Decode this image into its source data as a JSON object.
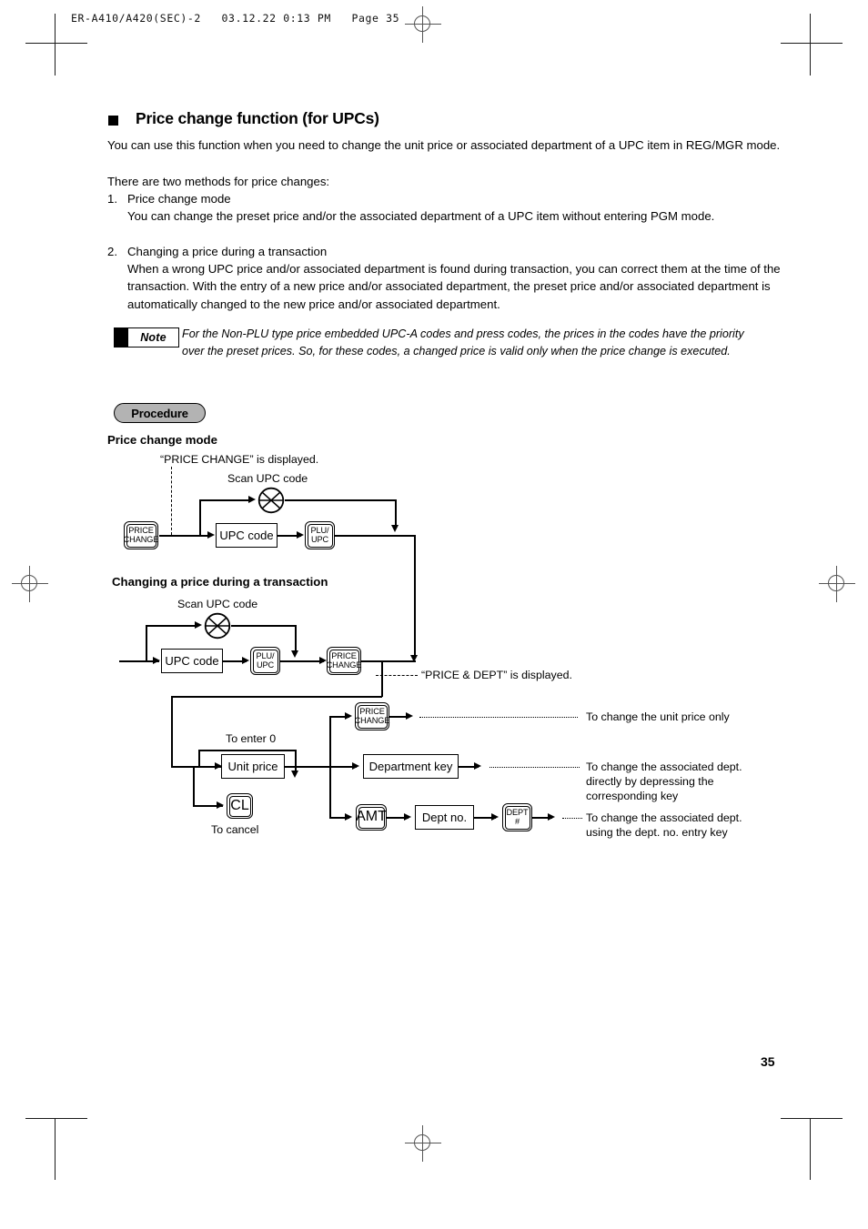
{
  "header": {
    "doc_code": "ER-A410/A420(SEC)-2   03.12.22 0:13 PM   Page 35"
  },
  "page": {
    "number": "35"
  },
  "section": {
    "title": "Price change function (for UPCs)",
    "intro": "You can use this function when you need to change the unit price or associated department of a UPC item in REG/MGR mode.",
    "methods_lead": "There are two methods for price changes:",
    "items": [
      {
        "num": "1.",
        "heading": "Price change mode",
        "body": "You can change the preset price and/or the associated department of a UPC item without entering PGM mode."
      },
      {
        "num": "2.",
        "heading": "Changing a price during a transaction",
        "body": "When a wrong UPC price and/or associated department is found during transaction, you can correct them at the time of the transaction. With the entry of a new price and/or associated department, the preset price and/or associated department is automatically changed to the new price and/or associated department."
      }
    ]
  },
  "note": {
    "badge": "Note",
    "text": "For the Non-PLU type price embedded UPC-A codes and press codes, the prices in the codes have the priority over the preset prices.  So, for these codes, a changed price is valid only when the price change is executed."
  },
  "procedure": {
    "badge": "Procedure"
  },
  "flow1": {
    "heading": "Price change mode",
    "display_note": "“PRICE CHANGE” is displayed.",
    "scan_label": "Scan UPC code",
    "key_price_change_l1": "PRICE",
    "key_price_change_l2": "CHANGE",
    "box_upc_code": "UPC code",
    "key_plu_l1": "PLU/",
    "key_plu_l2": "UPC"
  },
  "flow2": {
    "heading": "Changing a price during a transaction",
    "scan_label": "Scan UPC code",
    "box_upc_code": "UPC code",
    "key_plu_l1": "PLU/",
    "key_plu_l2": "UPC",
    "key_price_change_l1": "PRICE",
    "key_price_change_l2": "CHANGE",
    "display_note": "“PRICE & DEPT” is displayed."
  },
  "flow3": {
    "label_enter_zero": "To enter 0",
    "box_unit_price": "Unit price",
    "key_cl": "CL",
    "label_cancel": "To cancel",
    "branches": [
      {
        "key_l1": "PRICE",
        "key_l2": "CHANGE",
        "result": "To change the unit price only"
      },
      {
        "box": "Department key",
        "result": "To change the associated dept. directly by depressing the corresponding key"
      },
      {
        "key_amt": "AMT",
        "box_dept_no": "Dept no.",
        "key_dept_l1": "DEPT",
        "key_dept_l2": "#",
        "result": "To change the associated dept. using the dept. no. entry key"
      }
    ]
  }
}
